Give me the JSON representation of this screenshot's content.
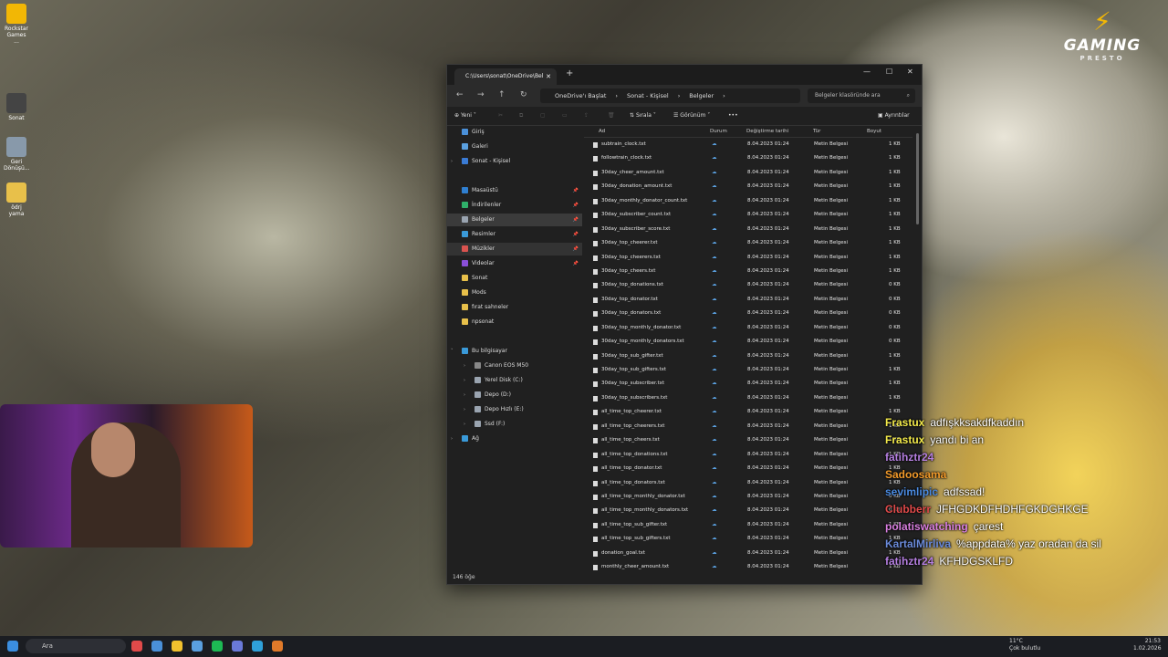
{
  "desktop": {
    "icons": [
      {
        "label": "Rockstar Games ...",
        "color": "#f2b705"
      },
      {
        "label": "Sonat",
        "color": "#444444"
      },
      {
        "label": "Geri Dönüşü...",
        "color": "#8899aa"
      },
      {
        "label": "ödrj yama",
        "color": "#e8c04a"
      }
    ],
    "brand": {
      "name": "GAMING",
      "sub": "PRESTO"
    }
  },
  "explorer": {
    "tab_title": "C:\\Users\\sonat\\OneDrive\\Bel",
    "breadcrumbs": [
      "OneDrive'ı Başlat",
      "Sonat - Kişisel",
      "Belgeler"
    ],
    "search_placeholder": "Belgeler klasöründe ara",
    "toolbar": {
      "new": "Yeni",
      "sort": "Sırala",
      "view": "Görünüm",
      "more": "•••",
      "details": "Ayrıntılar"
    },
    "columns": {
      "name": "Ad",
      "status": "Durum",
      "modified": "Değiştirme tarihi",
      "type": "Tür",
      "size": "Boyut"
    },
    "sidebar": [
      {
        "label": "Giriş",
        "color": "#4a90d9"
      },
      {
        "label": "Galeri",
        "color": "#5aa0e0"
      },
      {
        "label": "Sonat - Kişisel",
        "color": "#3a7bd5"
      },
      {
        "label": "Masaüstü",
        "color": "#2f7fd0"
      },
      {
        "label": "İndirilenler",
        "color": "#2fb06a"
      },
      {
        "label": "Belgeler",
        "color": "#9aa4b0"
      },
      {
        "label": "Resimler",
        "color": "#3a9ad9"
      },
      {
        "label": "Müzikler",
        "color": "#d9534f"
      },
      {
        "label": "Videolar",
        "color": "#8a4fd9"
      },
      {
        "label": "Sonat",
        "color": "#e8c04a"
      },
      {
        "label": "Mods",
        "color": "#e8c04a"
      },
      {
        "label": "fırat sahneler",
        "color": "#e8c04a"
      },
      {
        "label": "npsonat",
        "color": "#e8c04a"
      },
      {
        "label": "Bu bilgisayar",
        "color": "#3a9ad9"
      },
      {
        "label": "Canon EOS M50",
        "color": "#888888"
      },
      {
        "label": "Yerel Disk (C:)",
        "color": "#9aa4b0"
      },
      {
        "label": "Depo (D:)",
        "color": "#9aa4b0"
      },
      {
        "label": "Depo Hızlı (E:)",
        "color": "#9aa4b0"
      },
      {
        "label": "Ssd (F:)",
        "color": "#9aa4b0"
      },
      {
        "label": "Ağ",
        "color": "#3a9ad9"
      }
    ],
    "files": [
      {
        "name": "subtrain_clock.txt",
        "date": "8.04.2023 01:24",
        "type": "Metin Belgesi",
        "size": "1 KB"
      },
      {
        "name": "followtrain_clock.txt",
        "date": "8.04.2023 01:24",
        "type": "Metin Belgesi",
        "size": "1 KB"
      },
      {
        "name": "30day_cheer_amount.txt",
        "date": "8.04.2023 01:24",
        "type": "Metin Belgesi",
        "size": "1 KB"
      },
      {
        "name": "30day_donation_amount.txt",
        "date": "8.04.2023 01:24",
        "type": "Metin Belgesi",
        "size": "1 KB"
      },
      {
        "name": "30day_monthly_donator_count.txt",
        "date": "8.04.2023 01:24",
        "type": "Metin Belgesi",
        "size": "1 KB"
      },
      {
        "name": "30day_subscriber_count.txt",
        "date": "8.04.2023 01:24",
        "type": "Metin Belgesi",
        "size": "1 KB"
      },
      {
        "name": "30day_subscriber_score.txt",
        "date": "8.04.2023 01:24",
        "type": "Metin Belgesi",
        "size": "1 KB"
      },
      {
        "name": "30day_top_cheerer.txt",
        "date": "8.04.2023 01:24",
        "type": "Metin Belgesi",
        "size": "1 KB"
      },
      {
        "name": "30day_top_cheerers.txt",
        "date": "8.04.2023 01:24",
        "type": "Metin Belgesi",
        "size": "1 KB"
      },
      {
        "name": "30day_top_cheers.txt",
        "date": "8.04.2023 01:24",
        "type": "Metin Belgesi",
        "size": "1 KB"
      },
      {
        "name": "30day_top_donations.txt",
        "date": "8.04.2023 01:24",
        "type": "Metin Belgesi",
        "size": "0 KB"
      },
      {
        "name": "30day_top_donator.txt",
        "date": "8.04.2023 01:24",
        "type": "Metin Belgesi",
        "size": "0 KB"
      },
      {
        "name": "30day_top_donators.txt",
        "date": "8.04.2023 01:24",
        "type": "Metin Belgesi",
        "size": "0 KB"
      },
      {
        "name": "30day_top_monthly_donator.txt",
        "date": "8.04.2023 01:24",
        "type": "Metin Belgesi",
        "size": "0 KB"
      },
      {
        "name": "30day_top_monthly_donators.txt",
        "date": "8.04.2023 01:24",
        "type": "Metin Belgesi",
        "size": "0 KB"
      },
      {
        "name": "30day_top_sub_gifter.txt",
        "date": "8.04.2023 01:24",
        "type": "Metin Belgesi",
        "size": "1 KB"
      },
      {
        "name": "30day_top_sub_gifters.txt",
        "date": "8.04.2023 01:24",
        "type": "Metin Belgesi",
        "size": "1 KB"
      },
      {
        "name": "30day_top_subscriber.txt",
        "date": "8.04.2023 01:24",
        "type": "Metin Belgesi",
        "size": "1 KB"
      },
      {
        "name": "30day_top_subscribers.txt",
        "date": "8.04.2023 01:24",
        "type": "Metin Belgesi",
        "size": "1 KB"
      },
      {
        "name": "all_time_top_cheerer.txt",
        "date": "8.04.2023 01:24",
        "type": "Metin Belgesi",
        "size": "1 KB"
      },
      {
        "name": "all_time_top_cheerers.txt",
        "date": "8.04.2023 01:24",
        "type": "Metin Belgesi",
        "size": "1 KB"
      },
      {
        "name": "all_time_top_cheers.txt",
        "date": "8.04.2023 01:24",
        "type": "Metin Belgesi",
        "size": "1 KB"
      },
      {
        "name": "all_time_top_donations.txt",
        "date": "8.04.2023 01:24",
        "type": "Metin Belgesi",
        "size": "1 KB"
      },
      {
        "name": "all_time_top_donator.txt",
        "date": "8.04.2023 01:24",
        "type": "Metin Belgesi",
        "size": "1 KB"
      },
      {
        "name": "all_time_top_donators.txt",
        "date": "8.04.2023 01:24",
        "type": "Metin Belgesi",
        "size": "1 KB"
      },
      {
        "name": "all_time_top_monthly_donator.txt",
        "date": "8.04.2023 01:24",
        "type": "Metin Belgesi",
        "size": "0 KB"
      },
      {
        "name": "all_time_top_monthly_donators.txt",
        "date": "8.04.2023 01:24",
        "type": "Metin Belgesi",
        "size": "0 KB"
      },
      {
        "name": "all_time_top_sub_gifter.txt",
        "date": "8.04.2023 01:24",
        "type": "Metin Belgesi",
        "size": "1 KB"
      },
      {
        "name": "all_time_top_sub_gifters.txt",
        "date": "8.04.2023 01:24",
        "type": "Metin Belgesi",
        "size": "1 KB"
      },
      {
        "name": "donation_goal.txt",
        "date": "8.04.2023 01:24",
        "type": "Metin Belgesi",
        "size": "1 KB"
      },
      {
        "name": "monthly_cheer_amount.txt",
        "date": "8.04.2023 01:24",
        "type": "Metin Belgesi",
        "size": "1 KB"
      }
    ],
    "status_count": "146 öğe"
  },
  "chat": [
    {
      "user": "Frastux",
      "msg": "adfışkksakdfkaddın",
      "color": "#f2e94a"
    },
    {
      "user": "Frastux",
      "msg": "yandı bi an",
      "color": "#f2e94a"
    },
    {
      "user": "fatihztr24",
      "msg": "",
      "color": "#b57fe0"
    },
    {
      "user": "Sadoosama",
      "msg": "",
      "color": "#f29a2a"
    },
    {
      "user": "sevimlipic",
      "msg": "adfssad!",
      "color": "#4a8ae0"
    },
    {
      "user": "Clubberr",
      "msg": "JFHGDKDFHDHFGKDGHKGE",
      "color": "#e04a4a"
    },
    {
      "user": "polatiswatching",
      "msg": "çarest",
      "color": "#d97fe0"
    },
    {
      "user": "KartalMirliva",
      "msg": "%appdata% yaz oradan da sil",
      "color": "#6a8ad9"
    },
    {
      "user": "fatihztr24",
      "msg": "KFHDGSKLFD",
      "color": "#b57fe0"
    }
  ],
  "taskbar": {
    "search": "Ara",
    "weather_temp": "11°C",
    "weather_desc": "Çok bulutlu",
    "time": "21:53",
    "date": "1.02.2026",
    "apps": [
      "#e04a4a",
      "#4a90d9",
      "#f2c12e",
      "#5aa0e0",
      "#1db954",
      "#6a7ad9",
      "#2fa0d9",
      "#e07a2a"
    ]
  }
}
